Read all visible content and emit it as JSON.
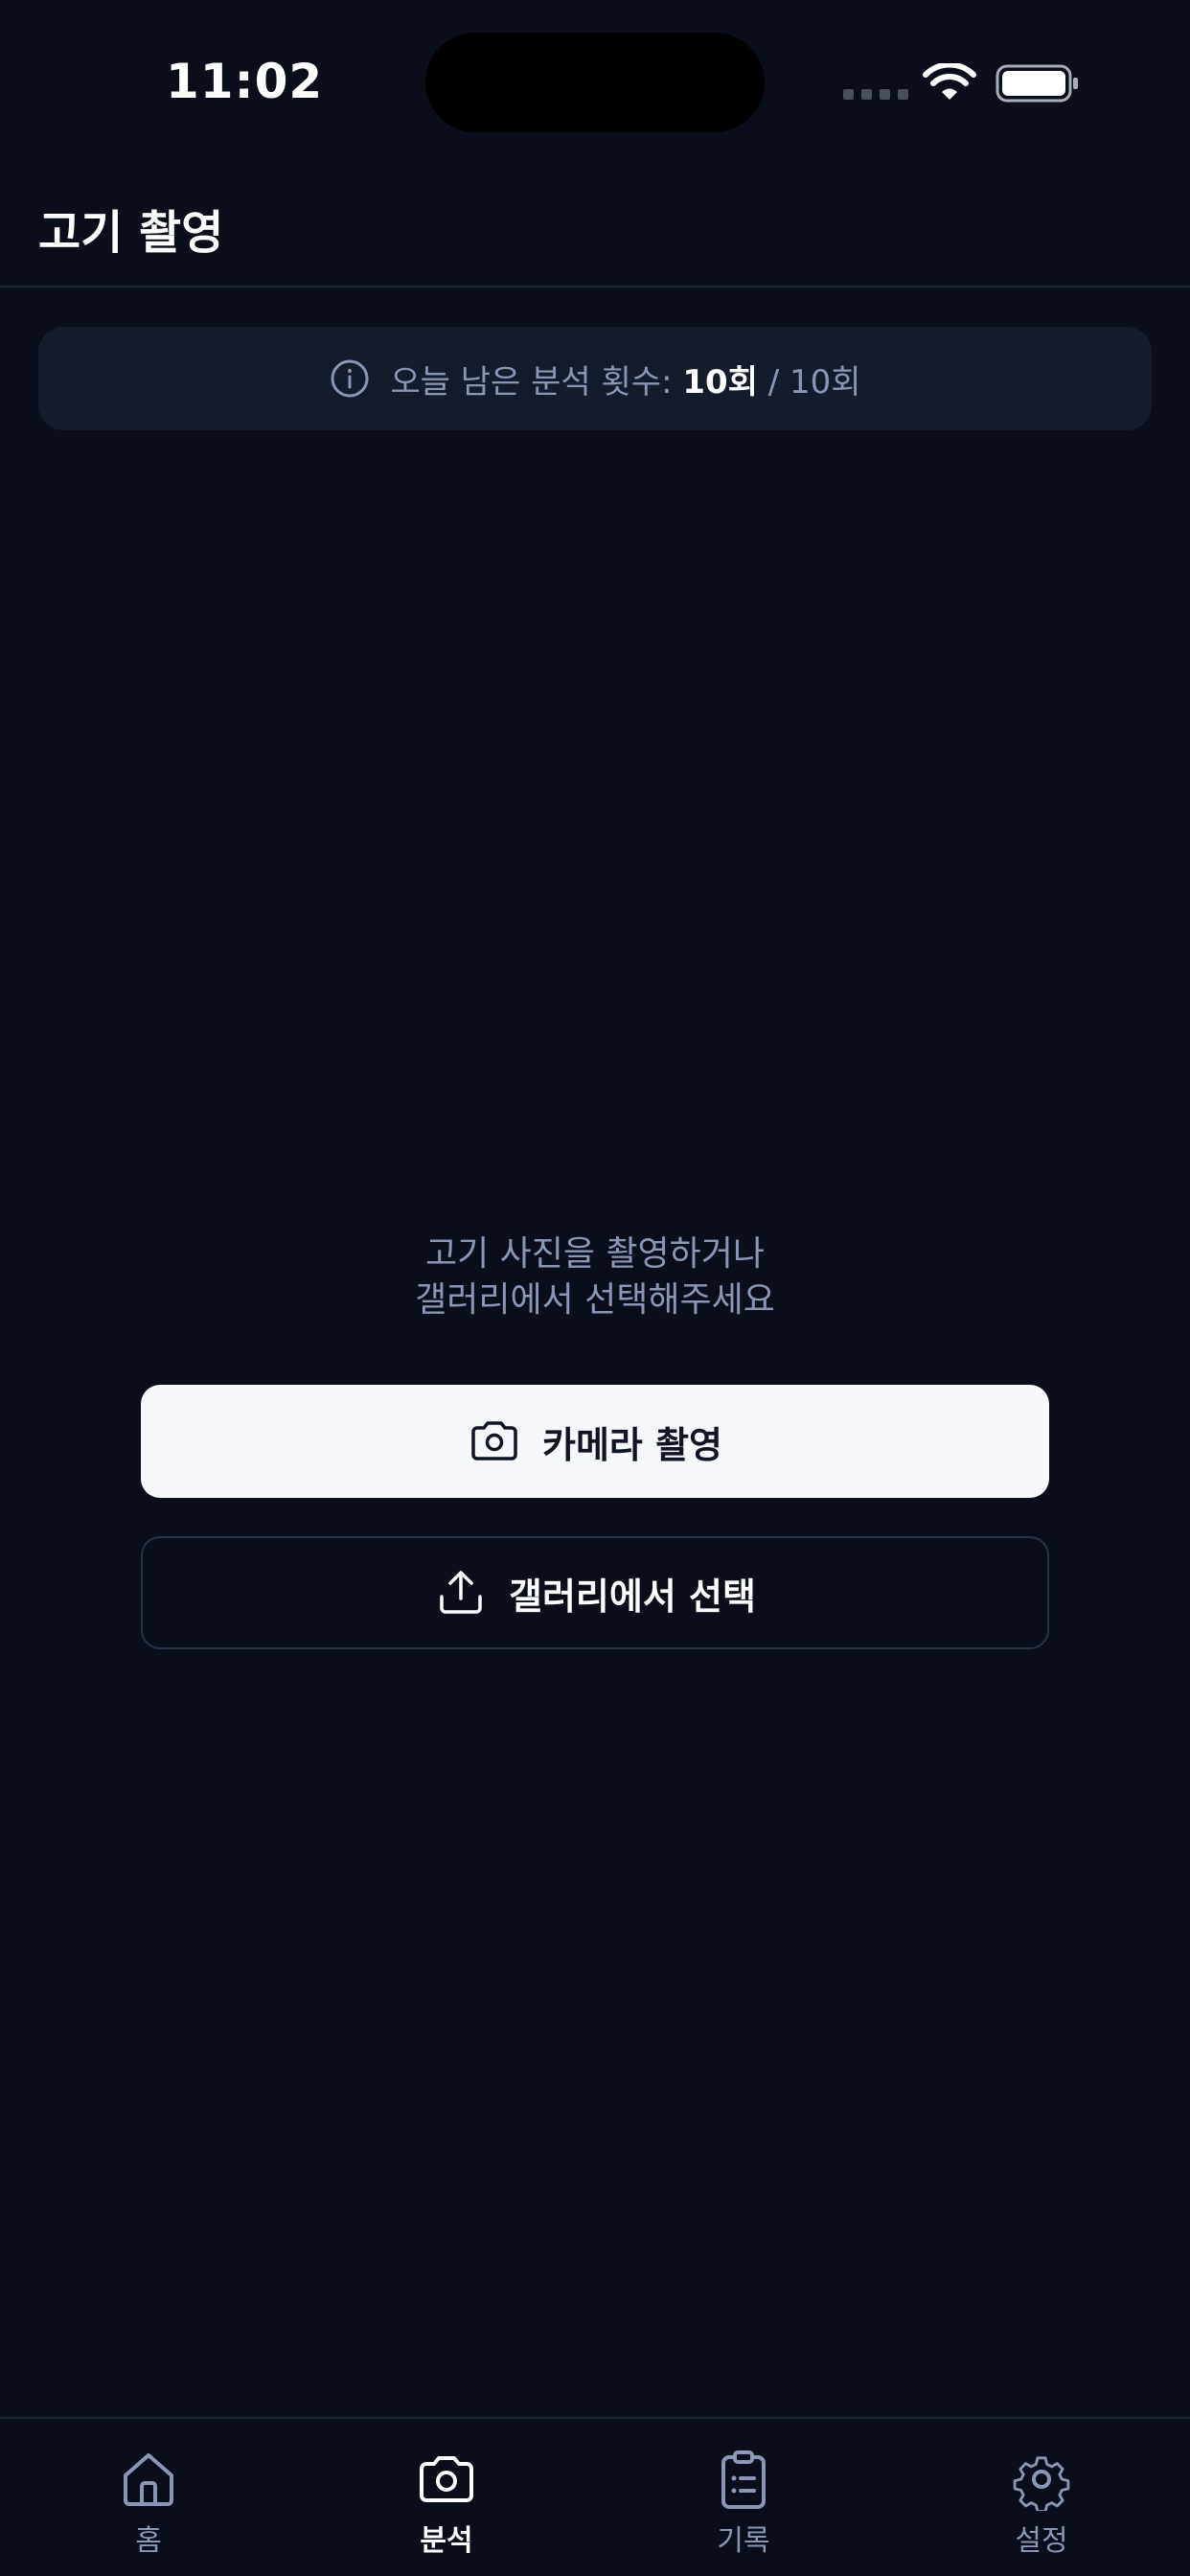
{
  "status_bar": {
    "time": "11:02"
  },
  "header": {
    "title": "고기 촬영"
  },
  "quota": {
    "label": "오늘 남은 분석 횟수:",
    "remaining": "10회",
    "separator": "/",
    "total": "10회"
  },
  "prompt": {
    "line1": "고기 사진을 촬영하거나",
    "line2": "갤러리에서 선택해주세요"
  },
  "buttons": {
    "camera_label": "카메라 촬영",
    "gallery_label": "갤러리에서 선택"
  },
  "tab_bar": {
    "items": [
      {
        "label": "홈",
        "icon": "home-icon",
        "active": false
      },
      {
        "label": "분석",
        "icon": "camera-icon",
        "active": true
      },
      {
        "label": "기록",
        "icon": "clipboard-icon",
        "active": false
      },
      {
        "label": "설정",
        "icon": "gear-icon",
        "active": false
      }
    ]
  },
  "colors": {
    "background": "#0a0e1a",
    "banner": "#141c2c",
    "muted_text": "#8a97b4",
    "primary_button": "#f6f8fb"
  }
}
